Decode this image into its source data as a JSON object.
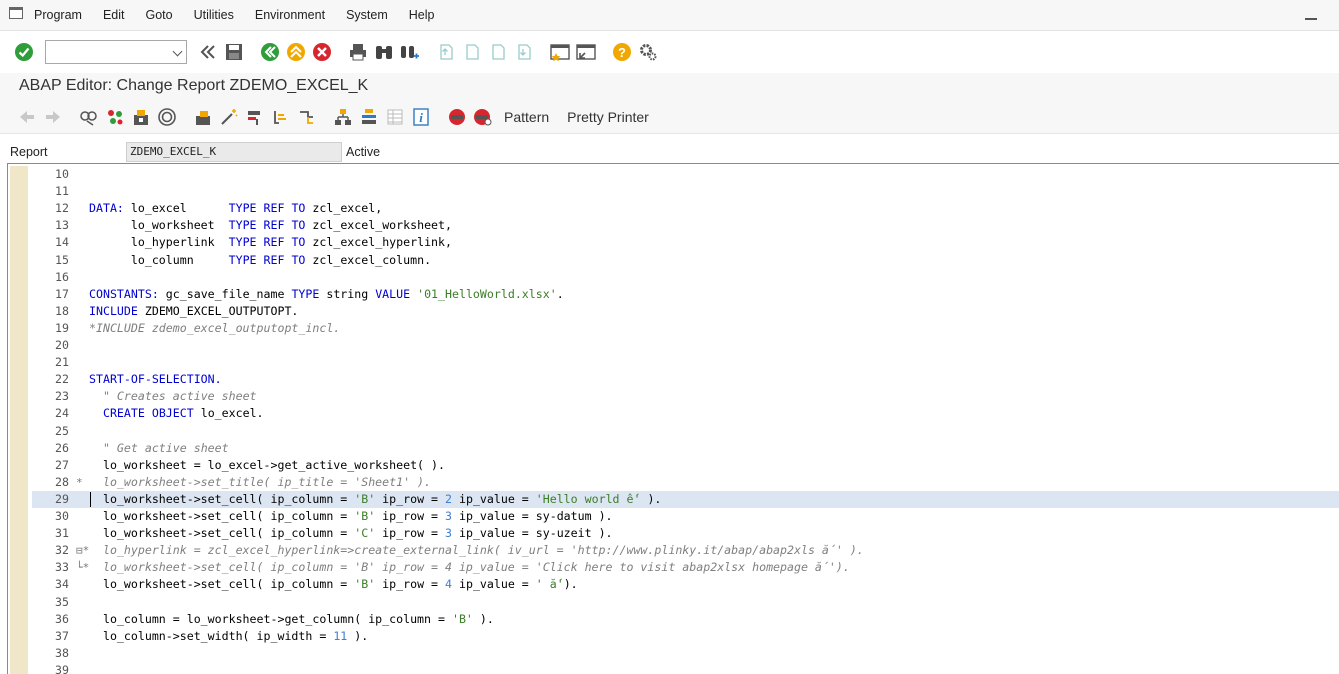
{
  "menu": [
    "Program",
    "Edit",
    "Goto",
    "Utilities",
    "Environment",
    "System",
    "Help"
  ],
  "toolbar": {
    "icons": [
      "enter-icon",
      "back-icon",
      "exit-icon",
      "cancel-icon",
      "print-icon",
      "find-icon",
      "find-next-icon",
      "first-page-icon",
      "previous-page-icon",
      "next-page-icon",
      "last-page-icon",
      "new-session-icon",
      "shortcut-icon",
      "help-icon",
      "settings-icon"
    ]
  },
  "title": "ABAP Editor: Change Report ZDEMO_EXCEL_K",
  "toolbar2": {
    "pattern_label": "Pattern",
    "pretty_printer_label": "Pretty Printer"
  },
  "report": {
    "label": "Report",
    "name": "ZDEMO_EXCEL_K",
    "status": "Active"
  },
  "colors": {
    "keyword": "#0000d0",
    "string": "#3a7d26",
    "number": "#3b7fd6",
    "comment": "#7f7f7f",
    "highlight": "#dce6f2"
  },
  "code_lines": [
    {
      "n": "10",
      "segs": []
    },
    {
      "n": "11",
      "segs": []
    },
    {
      "n": "12",
      "segs": [
        [
          "kw",
          "DATA:"
        ],
        [
          "t",
          " lo_excel      "
        ],
        [
          "kw",
          "TYPE"
        ],
        [
          "t",
          " "
        ],
        [
          "kw",
          "REF"
        ],
        [
          "t",
          " "
        ],
        [
          "kw",
          "TO"
        ],
        [
          "t",
          " zcl_excel,"
        ]
      ]
    },
    {
      "n": "13",
      "segs": [
        [
          "t",
          "      lo_worksheet  "
        ],
        [
          "kw",
          "TYPE"
        ],
        [
          "t",
          " "
        ],
        [
          "kw",
          "REF"
        ],
        [
          "t",
          " "
        ],
        [
          "kw",
          "TO"
        ],
        [
          "t",
          " zcl_excel_worksheet,"
        ]
      ]
    },
    {
      "n": "14",
      "segs": [
        [
          "t",
          "      lo_hyperlink  "
        ],
        [
          "kw",
          "TYPE"
        ],
        [
          "t",
          " "
        ],
        [
          "kw",
          "REF"
        ],
        [
          "t",
          " "
        ],
        [
          "kw",
          "TO"
        ],
        [
          "t",
          " zcl_excel_hyperlink,"
        ]
      ]
    },
    {
      "n": "15",
      "segs": [
        [
          "t",
          "      lo_column     "
        ],
        [
          "kw",
          "TYPE"
        ],
        [
          "t",
          " "
        ],
        [
          "kw",
          "REF"
        ],
        [
          "t",
          " "
        ],
        [
          "kw",
          "TO"
        ],
        [
          "t",
          " zcl_excel_column."
        ]
      ]
    },
    {
      "n": "16",
      "segs": []
    },
    {
      "n": "17",
      "segs": [
        [
          "kw",
          "CONSTANTS:"
        ],
        [
          "t",
          " gc_save_file_name "
        ],
        [
          "kw",
          "TYPE"
        ],
        [
          "t",
          " string "
        ],
        [
          "kw",
          "VALUE"
        ],
        [
          "t",
          " "
        ],
        [
          "str",
          "'01_HelloWorld.xlsx'"
        ],
        [
          "t",
          "."
        ]
      ]
    },
    {
      "n": "18",
      "segs": [
        [
          "kw",
          "INCLUDE"
        ],
        [
          "t",
          " ZDEMO_EXCEL_OUTPUTOPT."
        ]
      ]
    },
    {
      "n": "19",
      "segs": [
        [
          "cmt",
          "*INCLUDE zdemo_excel_outputopt_incl."
        ]
      ]
    },
    {
      "n": "20",
      "segs": []
    },
    {
      "n": "21",
      "segs": []
    },
    {
      "n": "22",
      "segs": [
        [
          "kw",
          "START-OF-SELECTION."
        ]
      ]
    },
    {
      "n": "23",
      "segs": [
        [
          "t",
          "  "
        ],
        [
          "cmt",
          "\" Creates active sheet"
        ]
      ]
    },
    {
      "n": "24",
      "segs": [
        [
          "t",
          "  "
        ],
        [
          "kw",
          "CREATE"
        ],
        [
          "t",
          " "
        ],
        [
          "kw",
          "OBJECT"
        ],
        [
          "t",
          " lo_excel."
        ]
      ]
    },
    {
      "n": "25",
      "segs": []
    },
    {
      "n": "26",
      "segs": [
        [
          "t",
          "  "
        ],
        [
          "cmt",
          "\" Get active sheet"
        ]
      ]
    },
    {
      "n": "27",
      "segs": [
        [
          "t",
          "  lo_worksheet = lo_excel->get_active_worksheet( )."
        ]
      ]
    },
    {
      "n": "28",
      "mark": "*",
      "segs": [
        [
          "cmt",
          "  lo_worksheet->set_title( ip_title = 'Sheet1' )."
        ]
      ]
    },
    {
      "n": "29",
      "hl": true,
      "segs": [
        [
          "t",
          "  lo_worksheet->set_cell( ip_column = "
        ],
        [
          "str",
          "'B'"
        ],
        [
          "t",
          " ip_row = "
        ],
        [
          "num",
          "2"
        ],
        [
          "t",
          " ip_value = "
        ],
        [
          "str",
          "'Hello world ế'"
        ],
        [
          "t",
          " )."
        ]
      ]
    },
    {
      "n": "30",
      "segs": [
        [
          "t",
          "  lo_worksheet->set_cell( ip_column = "
        ],
        [
          "str",
          "'B'"
        ],
        [
          "t",
          " ip_row = "
        ],
        [
          "num",
          "3"
        ],
        [
          "t",
          " ip_value = sy-datum )."
        ]
      ]
    },
    {
      "n": "31",
      "segs": [
        [
          "t",
          "  lo_worksheet->set_cell( ip_column = "
        ],
        [
          "str",
          "'C'"
        ],
        [
          "t",
          " ip_row = "
        ],
        [
          "num",
          "3"
        ],
        [
          "t",
          " ip_value = sy-uzeit )."
        ]
      ]
    },
    {
      "n": "32",
      "mark": "⊟*",
      "segs": [
        [
          "cmt",
          "  lo_hyperlink = zcl_excel_hyperlink=>create_external_link( iv_url = 'http://www.plinky.it/abap/abap2xls ắ' )."
        ]
      ]
    },
    {
      "n": "33",
      "mark": "└*",
      "segs": [
        [
          "cmt",
          "  lo_worksheet->set_cell( ip_column = 'B' ip_row = 4 ip_value = 'Click here to visit abap2xlsx homepage ắ')."
        ]
      ]
    },
    {
      "n": "34",
      "segs": [
        [
          "t",
          "  lo_worksheet->set_cell( ip_column = "
        ],
        [
          "str",
          "'B'"
        ],
        [
          "t",
          " ip_row = "
        ],
        [
          "num",
          "4"
        ],
        [
          "t",
          " ip_value = "
        ],
        [
          "str",
          "' ắ'"
        ],
        [
          "t",
          ")."
        ]
      ]
    },
    {
      "n": "35",
      "segs": []
    },
    {
      "n": "36",
      "segs": [
        [
          "t",
          "  lo_column = lo_worksheet->get_column( ip_column = "
        ],
        [
          "str",
          "'B'"
        ],
        [
          "t",
          " )."
        ]
      ]
    },
    {
      "n": "37",
      "segs": [
        [
          "t",
          "  lo_column->set_width( ip_width = "
        ],
        [
          "num",
          "11"
        ],
        [
          "t",
          " )."
        ]
      ]
    },
    {
      "n": "38",
      "segs": []
    },
    {
      "n": "39",
      "segs": []
    }
  ]
}
